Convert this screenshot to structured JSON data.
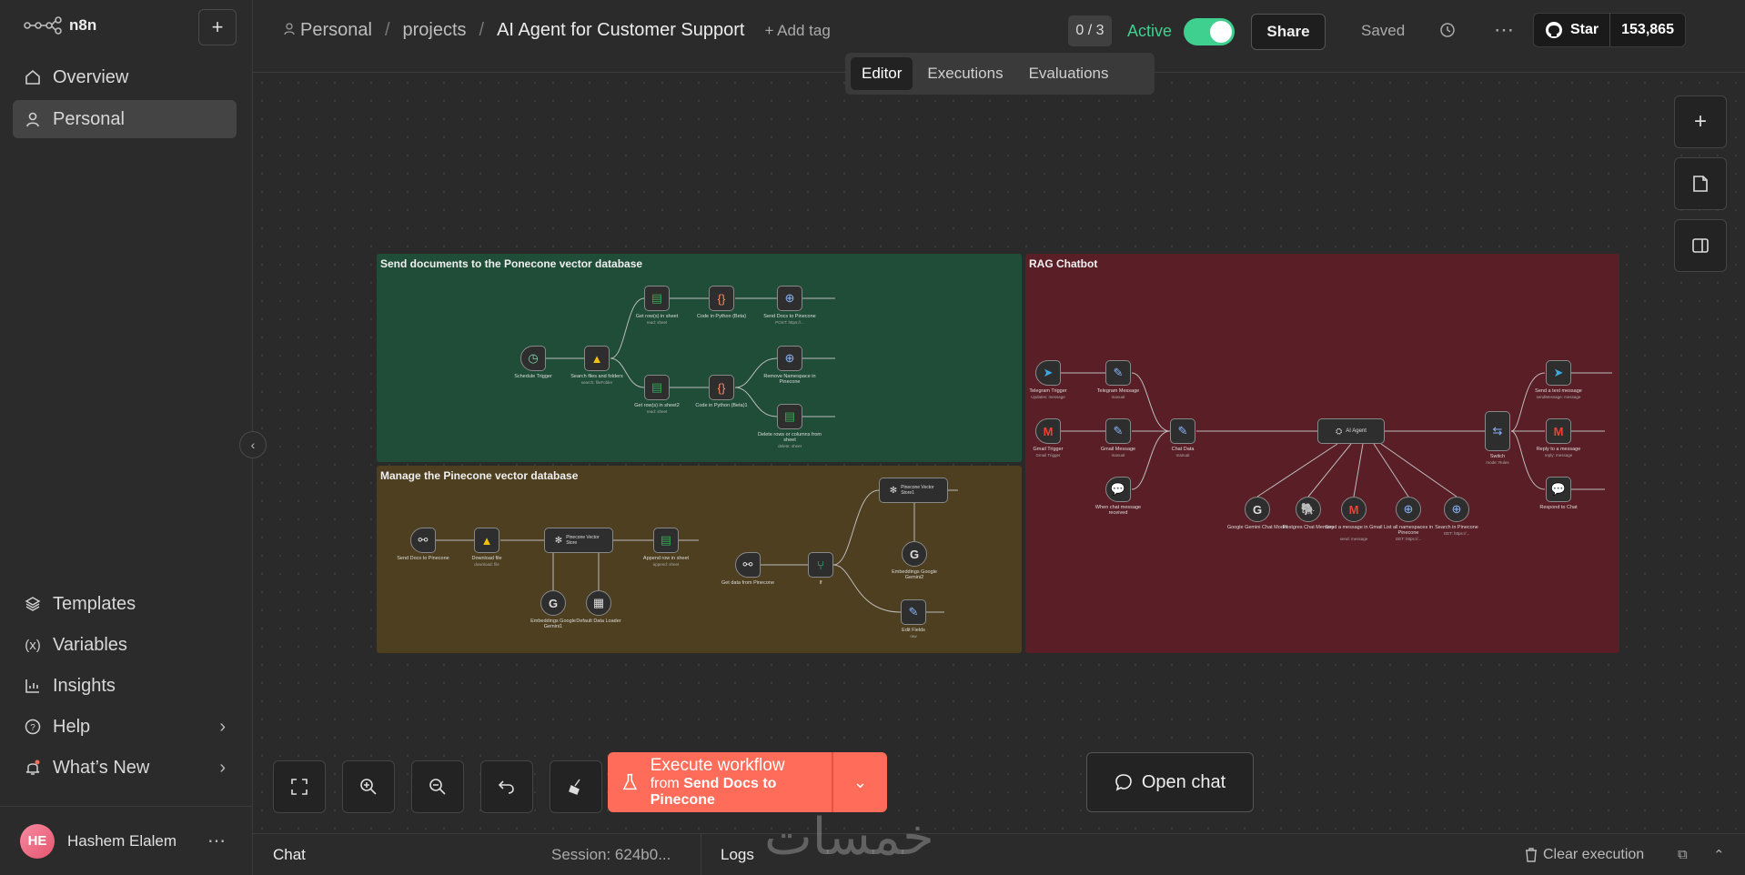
{
  "app": {
    "logo": "n8n"
  },
  "sidebar": {
    "items": [
      {
        "label": "Overview"
      },
      {
        "label": "Personal"
      }
    ],
    "bottom_items": [
      {
        "label": "Templates"
      },
      {
        "label": "Variables"
      },
      {
        "label": "Insights"
      },
      {
        "label": "Help"
      },
      {
        "label": "What’s New"
      }
    ],
    "user": {
      "initials": "HE",
      "name": "Hashem Elalem"
    }
  },
  "header": {
    "breadcrumb": [
      "Personal",
      "projects",
      "AI Agent for Customer Support"
    ],
    "add_tag": "+ Add tag",
    "counter": "0 / 3",
    "active_label": "Active",
    "share": "Share",
    "saved": "Saved",
    "github": {
      "star": "Star",
      "count": "153,865"
    }
  },
  "tabs": [
    "Editor",
    "Executions",
    "Evaluations"
  ],
  "stickies": [
    {
      "title": "Send documents to the Ponecone vector database",
      "color": "#1f4d38"
    },
    {
      "title": "Manage the Pinecone vector database",
      "color": "#4d3f1f"
    },
    {
      "title": "RAG Chatbot",
      "color": "#5a1f26"
    }
  ],
  "nodes": {
    "send": [
      {
        "label": "Schedule Trigger",
        "sub": ""
      },
      {
        "label": "Search files and folders",
        "sub": "search: fileFolder"
      },
      {
        "label": "Get row(s) in sheet",
        "sub": "read: sheet"
      },
      {
        "label": "Code in Python (Beta)",
        "sub": ""
      },
      {
        "label": "Send Docs to Pinecone",
        "sub": "POST: https://..."
      },
      {
        "label": "Get row(s) in sheet2",
        "sub": "read: sheet"
      },
      {
        "label": "Code in Python (Beta)1",
        "sub": ""
      },
      {
        "label": "Remove Namespace in Pinecone",
        "sub": ""
      },
      {
        "label": "Delete rows or columns from sheet",
        "sub": "delete: sheet"
      }
    ],
    "manage": [
      {
        "label": "Send Docs to Pinecone",
        "sub": ""
      },
      {
        "label": "Download file",
        "sub": "download: file"
      },
      {
        "label": "Pinecone Vector Store",
        "sub": ""
      },
      {
        "label": "Append row in sheet",
        "sub": "append: sheet"
      },
      {
        "label": "Embeddings Google Gemini1",
        "sub": ""
      },
      {
        "label": "Default Data Loader",
        "sub": ""
      },
      {
        "label": "Get data from Pinecone",
        "sub": ""
      },
      {
        "label": "If",
        "sub": ""
      },
      {
        "label": "Pinecone Vector Store1",
        "sub": ""
      },
      {
        "label": "Embeddings Google Gemini2",
        "sub": ""
      },
      {
        "label": "Edit Fields",
        "sub": "raw"
      }
    ],
    "rag": [
      {
        "label": "Telegram Trigger",
        "sub": "Updates: message"
      },
      {
        "label": "Telegram Message",
        "sub": "manual"
      },
      {
        "label": "Gmail Trigger",
        "sub": "Gmail Trigger"
      },
      {
        "label": "Gmail Message",
        "sub": "manual"
      },
      {
        "label": "When chat message received",
        "sub": ""
      },
      {
        "label": "Chat Data",
        "sub": "manual"
      },
      {
        "label": "AI Agent",
        "sub": ""
      },
      {
        "label": "Google Gemini Chat Model",
        "sub": ""
      },
      {
        "label": "Postgres Chat Memory",
        "sub": ""
      },
      {
        "label": "Send a message in Gmail",
        "sub": "send: message"
      },
      {
        "label": "List all namespaces in Pinecone",
        "sub": "GET: https://..."
      },
      {
        "label": "Search in Pinecone",
        "sub": "GET: https://..."
      },
      {
        "label": "Switch",
        "sub": "mode: Rules"
      },
      {
        "label": "Send a text message",
        "sub": "sendMessage: message"
      },
      {
        "label": "Reply to a message",
        "sub": "reply: message"
      },
      {
        "label": "Respond to Chat",
        "sub": ""
      }
    ]
  },
  "execute": {
    "title": "Execute workflow",
    "from": "from",
    "node": "Send Docs to Pinecone"
  },
  "open_chat": "Open chat",
  "bottom": {
    "chat": "Chat",
    "session": "Session: 624b0...",
    "logs": "Logs",
    "clear": "Clear execution"
  },
  "watermark": "خمسات"
}
